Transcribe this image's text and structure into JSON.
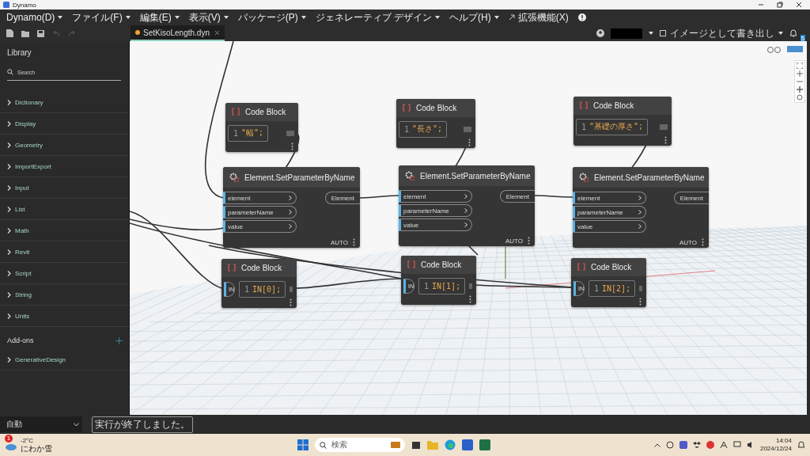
{
  "window": {
    "title": "Dynamo"
  },
  "menu": [
    {
      "label": "Dynamo(D)",
      "caret": true
    },
    {
      "label": "ファイル(F)",
      "caret": true
    },
    {
      "label": "編集(E)",
      "caret": true
    },
    {
      "label": "表示(V)",
      "caret": true
    },
    {
      "label": "パッケージ(P)",
      "caret": true
    },
    {
      "label": "ジェネレーティブ デザイン",
      "caret": true
    },
    {
      "label": "ヘルプ(H)",
      "caret": true
    },
    {
      "label": "拡張機能(X)",
      "caret": false
    }
  ],
  "tabs": [
    {
      "label": "SetKisoLength.dyn",
      "selected": true,
      "modified": true
    }
  ],
  "toolbar_right": {
    "export_label": "イメージとして書き出し",
    "notification_count": "5"
  },
  "library": {
    "title": "Library",
    "search": {
      "placeholder": "Search"
    },
    "categories": [
      {
        "label": "Dictionary",
        "expanded": false
      },
      {
        "label": "Display",
        "expanded": false
      },
      {
        "label": "Geometry",
        "expanded": false
      },
      {
        "label": "ImportExport",
        "expanded": false
      },
      {
        "label": "Input",
        "expanded": false
      },
      {
        "label": "List",
        "expanded": false
      },
      {
        "label": "Math",
        "expanded": false
      },
      {
        "label": "Revit",
        "expanded": false
      },
      {
        "label": "Script",
        "expanded": false
      },
      {
        "label": "String",
        "expanded": false
      },
      {
        "label": "Units",
        "expanded": false
      }
    ],
    "addons_title": "Add-ons",
    "addons": [
      {
        "label": "GenerativeDesign",
        "expanded": false
      }
    ]
  },
  "nodes": [
    {
      "kind": "code",
      "title": "Code Block",
      "line": "1",
      "code": "\"幅\";"
    },
    {
      "kind": "code",
      "title": "Code Block",
      "line": "1",
      "code": "\"長さ\";"
    },
    {
      "kind": "code",
      "title": "Code Block",
      "line": "1",
      "code": "\"基礎の厚さ\";"
    },
    {
      "kind": "function",
      "title": "Element.SetParameterByName",
      "inputs": [
        "element",
        "parameterName",
        "value"
      ],
      "output": "Element",
      "lacing": "AUTO"
    },
    {
      "kind": "function",
      "title": "Element.SetParameterByName",
      "inputs": [
        "element",
        "parameterName",
        "value"
      ],
      "output": "Element",
      "lacing": "AUTO"
    },
    {
      "kind": "function",
      "title": "Element.SetParameterByName",
      "inputs": [
        "element",
        "parameterName",
        "value"
      ],
      "output": "Element",
      "lacing": "AUTO"
    },
    {
      "kind": "code",
      "title": "Code Block",
      "line": "1",
      "code": "IN[0];",
      "inputs": [
        "IN"
      ]
    },
    {
      "kind": "code",
      "title": "Code Block",
      "line": "1",
      "code": "IN[1];",
      "inputs": [
        "IN"
      ]
    },
    {
      "kind": "code",
      "title": "Code Block",
      "line": "1",
      "code": "IN[2];",
      "inputs": [
        "IN"
      ]
    }
  ],
  "status_bar": {
    "run_mode": "自動",
    "message": "実行が終了しました。"
  },
  "taskbar": {
    "weather_badge": "1",
    "temperature": "-2°C",
    "weather": "にわか雪",
    "search_placeholder": "検索",
    "time": "14:04",
    "date": "2024/12/24"
  }
}
